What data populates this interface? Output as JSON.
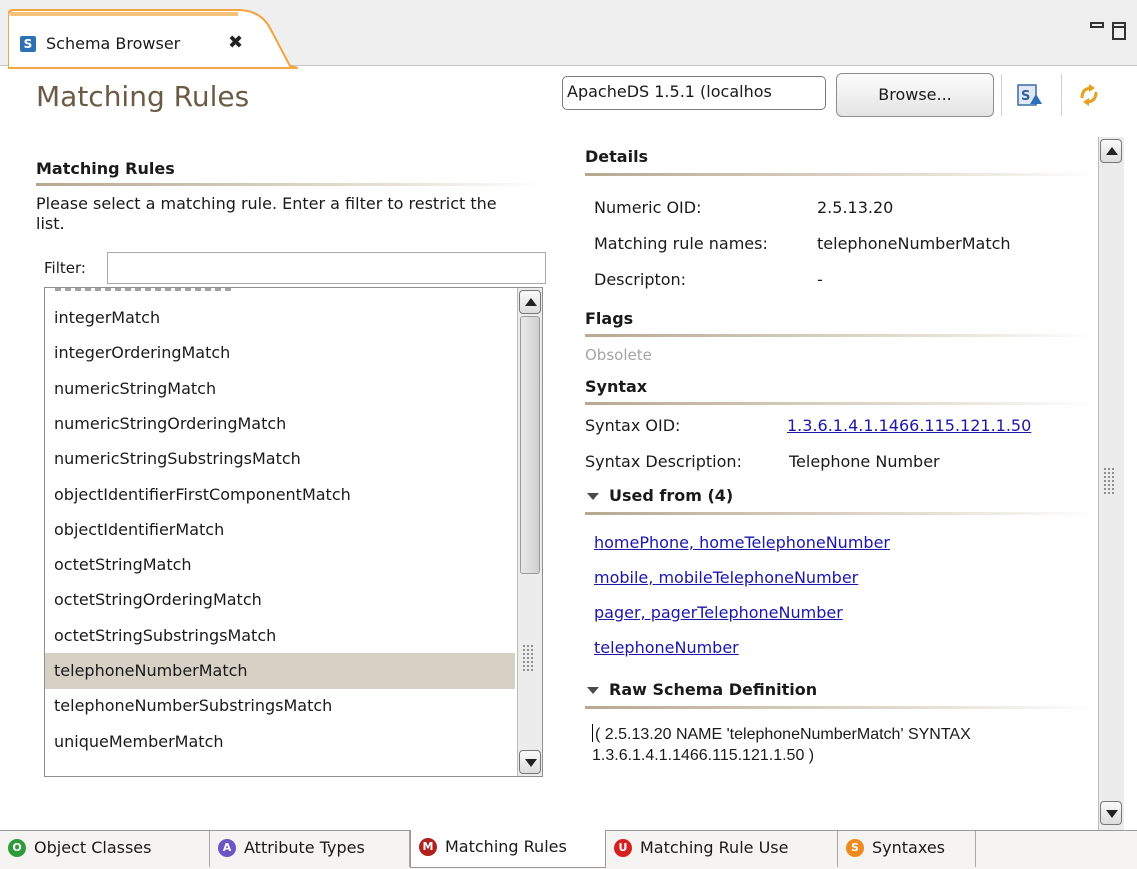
{
  "view_tab": {
    "title": "Schema Browser"
  },
  "page": {
    "title": "Matching Rules"
  },
  "toolbar": {
    "connection_value": "ApacheDS 1.5.1 (localhos",
    "browse_label": "Browse..."
  },
  "left": {
    "section_title": "Matching Rules",
    "description": "Please select a matching rule. Enter a filter to restrict the list.",
    "filter_label": "Filter:",
    "filter_value": "",
    "items": [
      "integerMatch",
      "integerOrderingMatch",
      "numericStringMatch",
      "numericStringOrderingMatch",
      "numericStringSubstringsMatch",
      "objectIdentifierFirstComponentMatch",
      "objectIdentifierMatch",
      "octetStringMatch",
      "octetStringOrderingMatch",
      "octetStringSubstringsMatch",
      "telephoneNumberMatch",
      "telephoneNumberSubstringsMatch",
      "uniqueMemberMatch"
    ],
    "selected_item": "telephoneNumberMatch"
  },
  "details": {
    "title": "Details",
    "oid_label": "Numeric OID:",
    "oid_value": "2.5.13.20",
    "names_label": "Matching rule names:",
    "names_value": "telephoneNumberMatch",
    "description_label": "Descripton:",
    "description_value": "-"
  },
  "flags": {
    "title": "Flags",
    "obsolete_label": "Obsolete"
  },
  "syntax": {
    "title": "Syntax",
    "oid_label": "Syntax OID:",
    "oid_value": "1.3.6.1.4.1.1466.115.121.1.50",
    "description_label": "Syntax Description:",
    "description_value": "Telephone Number"
  },
  "used_from": {
    "title": "Used from (4)",
    "links": [
      "homePhone, homeTelephoneNumber",
      "mobile, mobileTelephoneNumber",
      "pager, pagerTelephoneNumber",
      "telephoneNumber"
    ]
  },
  "raw_schema": {
    "title": "Raw Schema Definition",
    "text": "( 2.5.13.20 NAME 'telephoneNumberMatch' SYNTAX 1.3.6.1.4.1.1466.115.121.1.50 )"
  },
  "bottom_tabs": [
    {
      "label": "Object Classes",
      "icon": "O",
      "color": "#2e9a3a"
    },
    {
      "label": "Attribute Types",
      "icon": "A",
      "color": "#6a57c4"
    },
    {
      "label": "Matching Rules",
      "icon": "M",
      "color": "#b0201d"
    },
    {
      "label": "Matching Rule Use",
      "icon": "U",
      "color": "#d42020"
    },
    {
      "label": "Syntaxes",
      "icon": "S",
      "color": "#ef8a1f"
    }
  ],
  "active_tab": "Matching Rules",
  "colors": {
    "page_title": "#6c5b43",
    "link": "#1b17a8",
    "tab_accent": "#f2a540",
    "selection": "#d6d0c5"
  }
}
